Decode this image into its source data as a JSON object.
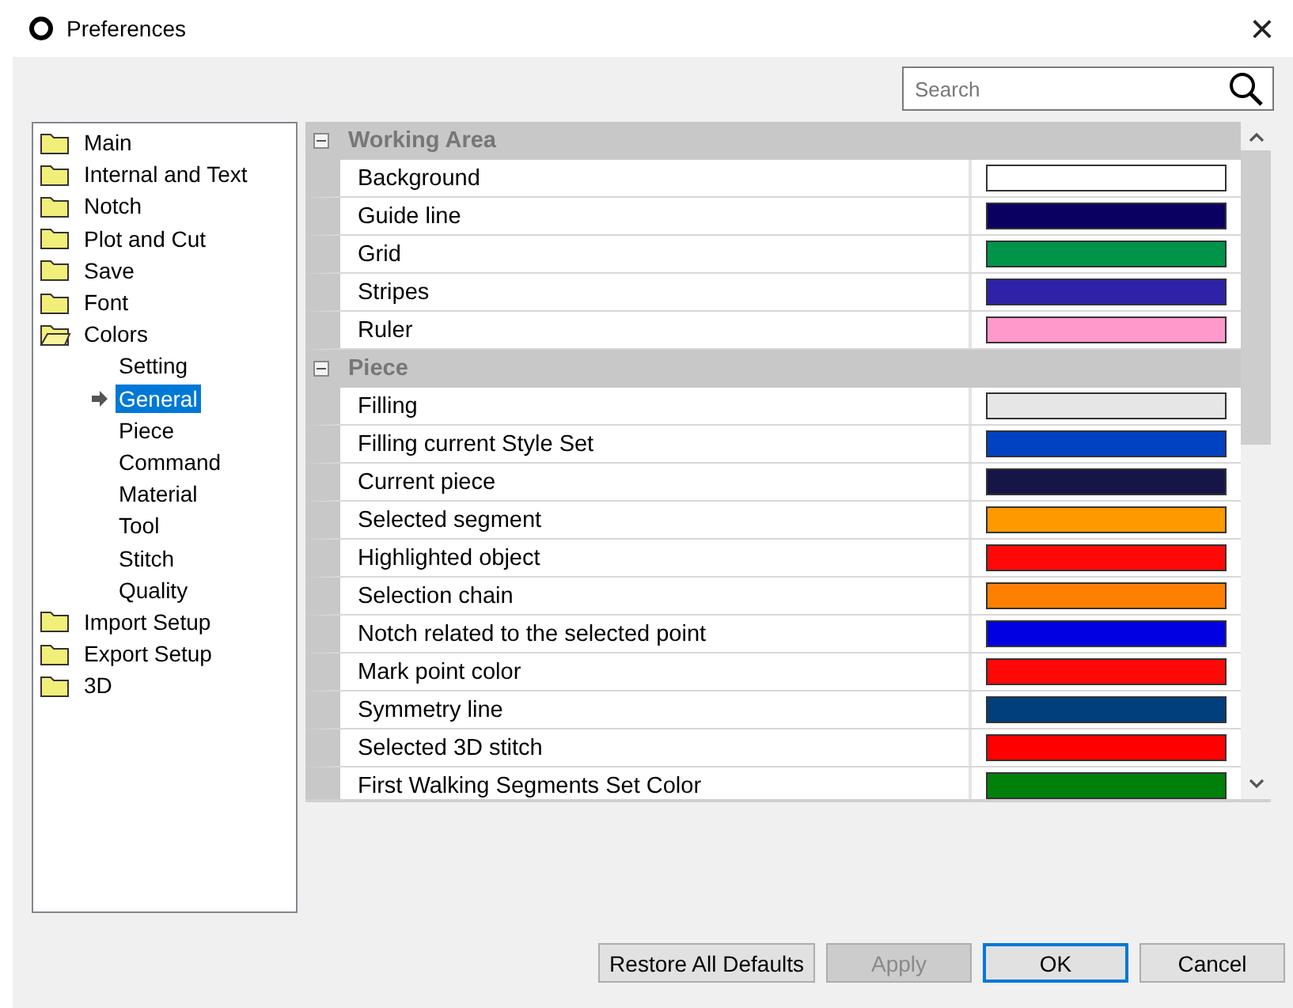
{
  "window": {
    "title": "Preferences",
    "close": "×"
  },
  "search": {
    "placeholder": "Search"
  },
  "tree": [
    {
      "label": "Main",
      "expanded": false,
      "selected": false
    },
    {
      "label": "Internal and Text",
      "expanded": false,
      "selected": false
    },
    {
      "label": "Notch",
      "expanded": false,
      "selected": false
    },
    {
      "label": "Plot and Cut",
      "expanded": false,
      "selected": false
    },
    {
      "label": "Save",
      "expanded": false,
      "selected": false
    },
    {
      "label": "Font",
      "expanded": false,
      "selected": false
    },
    {
      "label": "Colors",
      "expanded": true,
      "selected": false,
      "children": [
        {
          "label": "Setting",
          "selected": false
        },
        {
          "label": "General",
          "selected": true
        },
        {
          "label": "Piece",
          "selected": false
        },
        {
          "label": "Command",
          "selected": false
        },
        {
          "label": "Material",
          "selected": false
        },
        {
          "label": "Tool",
          "selected": false
        },
        {
          "label": "Stitch",
          "selected": false
        },
        {
          "label": "Quality",
          "selected": false
        }
      ]
    },
    {
      "label": "Import Setup",
      "expanded": false,
      "selected": false
    },
    {
      "label": "Export Setup",
      "expanded": false,
      "selected": false
    },
    {
      "label": "3D",
      "expanded": false,
      "selected": false
    }
  ],
  "sections": [
    {
      "title": "Working Area",
      "expanded": true,
      "rows": [
        {
          "label": "Background",
          "color": "#ffffff"
        },
        {
          "label": "Guide line",
          "color": "#0a0060"
        },
        {
          "label": "Grid",
          "color": "#00944a"
        },
        {
          "label": "Stripes",
          "color": "#2e22a8"
        },
        {
          "label": "Ruler",
          "color": "#ff99cc"
        }
      ]
    },
    {
      "title": "Piece",
      "expanded": true,
      "rows": [
        {
          "label": "Filling",
          "color": "#e6e6e6"
        },
        {
          "label": "Filling current Style Set",
          "color": "#0042c2"
        },
        {
          "label": "Current piece",
          "color": "#171447"
        },
        {
          "label": "Selected segment",
          "color": "#ff9900"
        },
        {
          "label": "Highlighted object",
          "color": "#ff0808"
        },
        {
          "label": "Selection chain",
          "color": "#ff8000"
        },
        {
          "label": "Notch related to the selected point",
          "color": "#0000e0"
        },
        {
          "label": "Mark point color",
          "color": "#ff0808"
        },
        {
          "label": "Symmetry line",
          "color": "#003f7c"
        },
        {
          "label": "Selected 3D stitch",
          "color": "#ff0000"
        },
        {
          "label": "First Walking Segments Set Color",
          "color": "#00800b"
        }
      ]
    }
  ],
  "buttons": [
    {
      "label": "Restore All Defaults",
      "disabled": false,
      "selected": false
    },
    {
      "label": "Apply",
      "disabled": true,
      "selected": false
    },
    {
      "label": "OK",
      "disabled": false,
      "selected": true
    },
    {
      "label": "Cancel",
      "disabled": false,
      "selected": false
    }
  ]
}
